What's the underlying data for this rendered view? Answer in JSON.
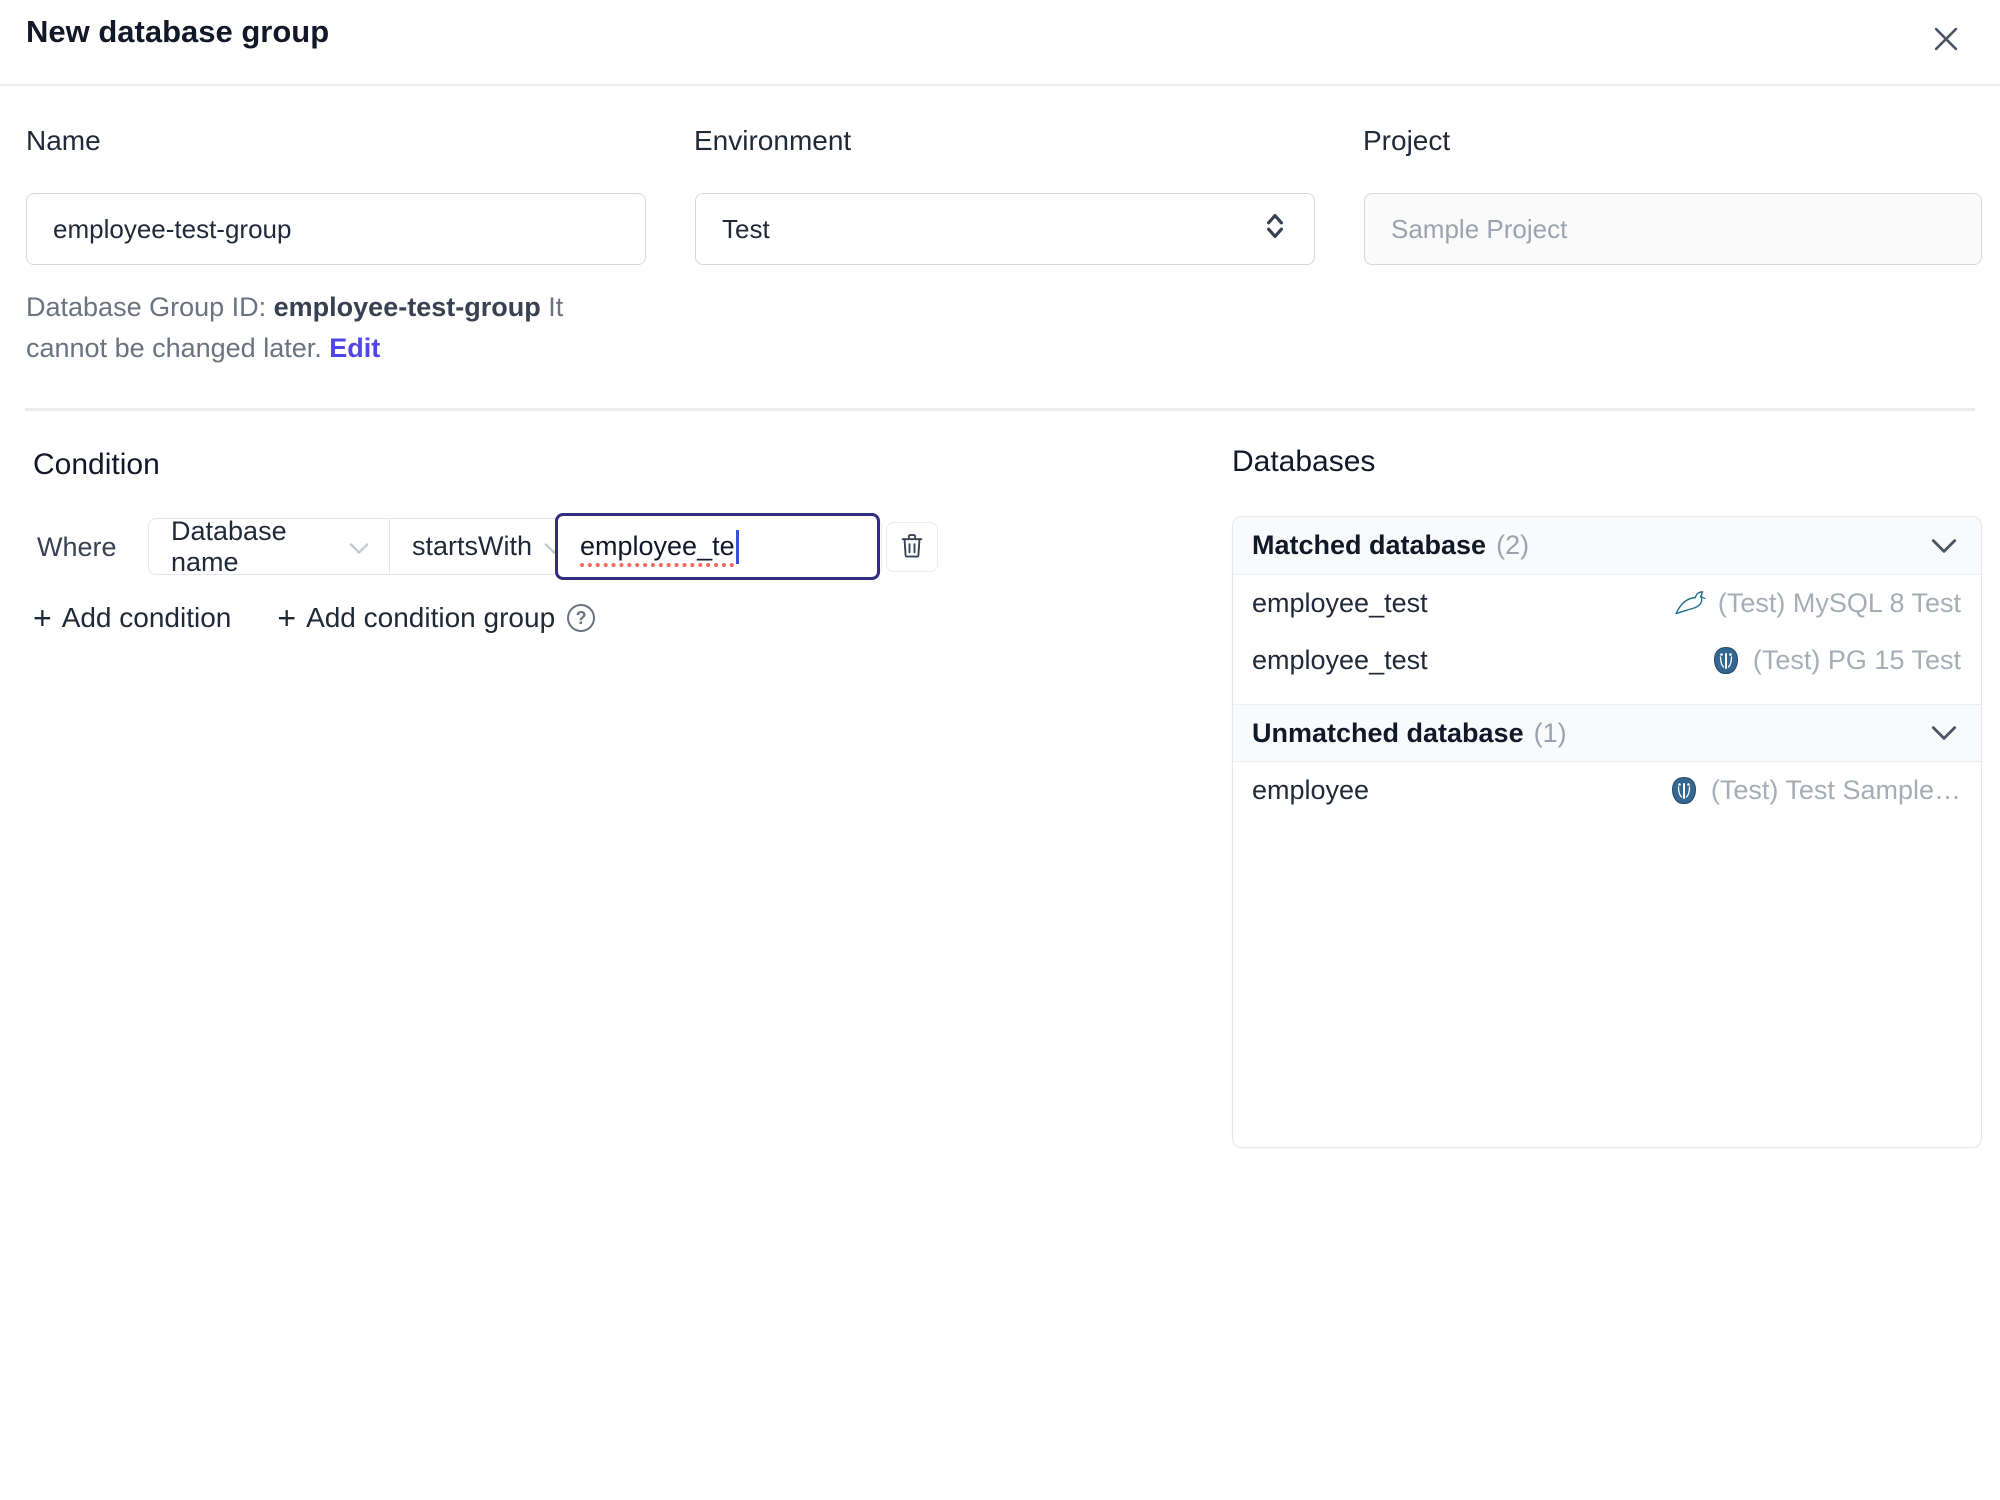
{
  "dialog": {
    "title": "New database group"
  },
  "icons": {
    "close": "close-icon",
    "plus": "+",
    "help": "?"
  },
  "form": {
    "name_label": "Name",
    "name_value": "employee-test-group",
    "environment_label": "Environment",
    "environment_value": "Test",
    "project_label": "Project",
    "project_value": "Sample Project",
    "group_id": {
      "prefix": "Database Group ID:",
      "value": "employee-test-group",
      "suffix": "It cannot be changed later.",
      "edit": "Edit"
    }
  },
  "condition": {
    "heading": "Condition",
    "where": "Where",
    "field": "Database name",
    "operator": "startsWith",
    "value": "employee_te",
    "add_condition": "Add condition",
    "add_condition_group": "Add condition group"
  },
  "databases": {
    "heading": "Databases",
    "sections": [
      {
        "title": "Matched database",
        "count": "(2)",
        "rows": [
          {
            "name": "employee_test",
            "engine": "mysql",
            "instance": "(Test) MySQL 8 Test"
          },
          {
            "name": "employee_test",
            "engine": "postgres",
            "instance": "(Test) PG 15 Test"
          }
        ]
      },
      {
        "title": "Unmatched database",
        "count": "(1)",
        "rows": [
          {
            "name": "employee",
            "engine": "postgres",
            "instance": "(Test) Test Sample…"
          }
        ]
      }
    ]
  },
  "colors": {
    "accent_link": "#4f46e5",
    "focus_border": "#312e81",
    "mysql_teal": "#00758f",
    "postgres_blue": "#336791",
    "spellcheck_red": "#ef6a5f",
    "muted_text": "#9ca3af",
    "border": "#e5e7eb"
  }
}
